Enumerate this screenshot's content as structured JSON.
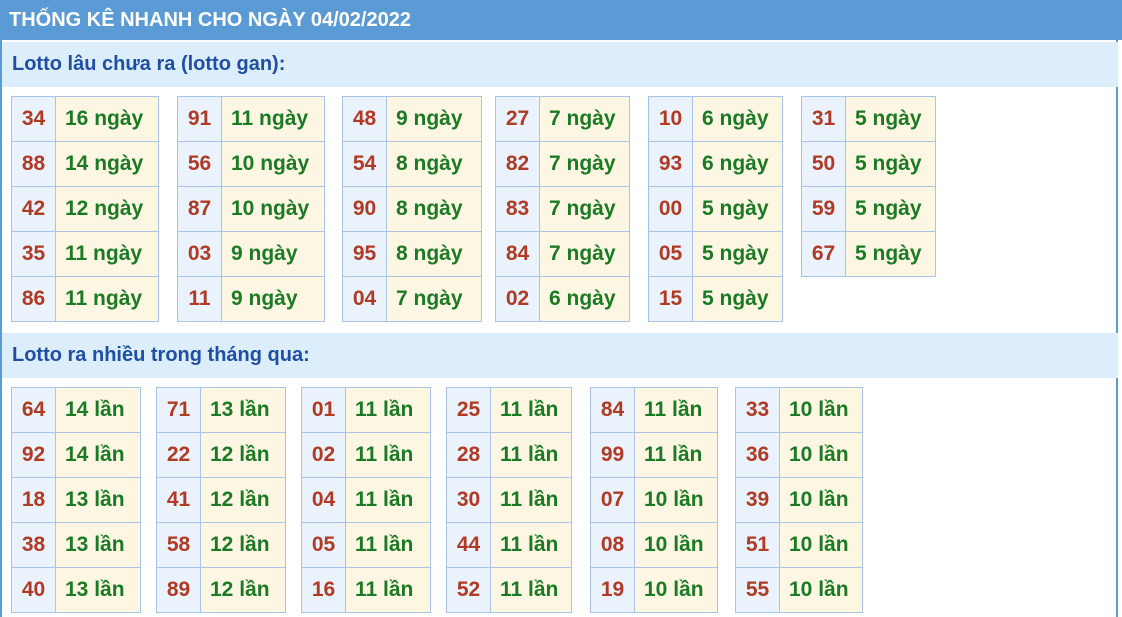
{
  "title": "THỐNG KÊ NHANH CHO NGÀY 04/02/2022",
  "sections": [
    {
      "heading": "Lotto lâu chưa ra (lotto gan):",
      "groups": [
        [
          [
            "34",
            "16 ngày"
          ],
          [
            "88",
            "14 ngày"
          ],
          [
            "42",
            "12 ngày"
          ],
          [
            "35",
            "11 ngày"
          ],
          [
            "86",
            "11 ngày"
          ]
        ],
        [
          [
            "91",
            "11 ngày"
          ],
          [
            "56",
            "10 ngày"
          ],
          [
            "87",
            "10 ngày"
          ],
          [
            "03",
            "9 ngày"
          ],
          [
            "11",
            "9 ngày"
          ]
        ],
        [
          [
            "48",
            "9 ngày"
          ],
          [
            "54",
            "8 ngày"
          ],
          [
            "90",
            "8 ngày"
          ],
          [
            "95",
            "8 ngày"
          ],
          [
            "04",
            "7 ngày"
          ]
        ],
        [
          [
            "27",
            "7 ngày"
          ],
          [
            "82",
            "7 ngày"
          ],
          [
            "83",
            "7 ngày"
          ],
          [
            "84",
            "7 ngày"
          ],
          [
            "02",
            "6 ngày"
          ]
        ],
        [
          [
            "10",
            "6 ngày"
          ],
          [
            "93",
            "6 ngày"
          ],
          [
            "00",
            "5 ngày"
          ],
          [
            "05",
            "5 ngày"
          ],
          [
            "15",
            "5 ngày"
          ]
        ],
        [
          [
            "31",
            "5 ngày"
          ],
          [
            "50",
            "5 ngày"
          ],
          [
            "59",
            "5 ngày"
          ],
          [
            "67",
            "5 ngày"
          ]
        ]
      ]
    },
    {
      "heading": "Lotto ra nhiều trong tháng qua:",
      "groups": [
        [
          [
            "64",
            "14 lần"
          ],
          [
            "92",
            "14 lần"
          ],
          [
            "18",
            "13 lần"
          ],
          [
            "38",
            "13 lần"
          ],
          [
            "40",
            "13 lần"
          ]
        ],
        [
          [
            "71",
            "13 lần"
          ],
          [
            "22",
            "12 lần"
          ],
          [
            "41",
            "12 lần"
          ],
          [
            "58",
            "12 lần"
          ],
          [
            "89",
            "12 lần"
          ]
        ],
        [
          [
            "01",
            "11 lần"
          ],
          [
            "02",
            "11 lần"
          ],
          [
            "04",
            "11 lần"
          ],
          [
            "05",
            "11 lần"
          ],
          [
            "16",
            "11 lần"
          ]
        ],
        [
          [
            "25",
            "11 lần"
          ],
          [
            "28",
            "11 lần"
          ],
          [
            "30",
            "11 lần"
          ],
          [
            "44",
            "11 lần"
          ],
          [
            "52",
            "11 lần"
          ]
        ],
        [
          [
            "84",
            "11 lần"
          ],
          [
            "99",
            "11 lần"
          ],
          [
            "07",
            "10 lần"
          ],
          [
            "08",
            "10 lần"
          ],
          [
            "19",
            "10 lần"
          ]
        ],
        [
          [
            "33",
            "10 lần"
          ],
          [
            "36",
            "10 lần"
          ],
          [
            "39",
            "10 lần"
          ],
          [
            "51",
            "10 lần"
          ],
          [
            "55",
            "10 lần"
          ]
        ]
      ]
    }
  ]
}
